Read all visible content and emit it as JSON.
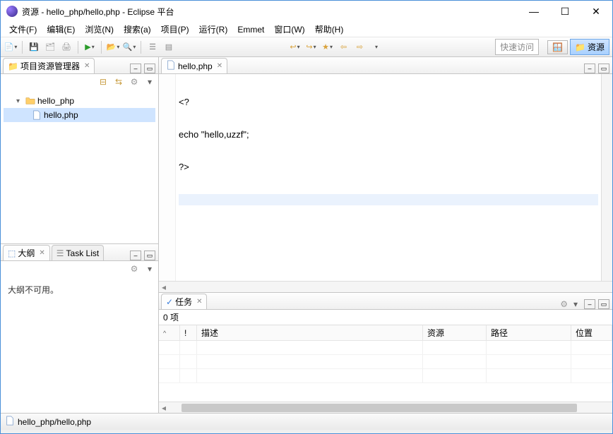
{
  "window": {
    "title": "资源 - hello_php/hello,php - Eclipse 平台"
  },
  "menu": {
    "file": "文件(F)",
    "edit": "编辑(E)",
    "navigate": "浏览(N)",
    "search": "搜索(a)",
    "project": "项目(P)",
    "run": "运行(R)",
    "emmet": "Emmet",
    "window": "窗口(W)",
    "help": "帮助(H)"
  },
  "toolbar": {
    "quick_access_placeholder": "快速访问",
    "perspective_label": "资源"
  },
  "explorer": {
    "tab_label": "项目资源管理器",
    "project_name": "hello_php",
    "file_name": "hello,php"
  },
  "outline": {
    "tab_label": "大纲",
    "tasklist_tab_label": "Task List",
    "empty_text": "大纲不可用。"
  },
  "editor": {
    "tab_label": "hello,php",
    "lines": [
      "<?",
      "echo \"hello,uzzf\";",
      "?>",
      ""
    ]
  },
  "tasks": {
    "tab_label": "任务",
    "count_text": "0 项",
    "columns": {
      "col0": "",
      "col1": "!",
      "col2": "描述",
      "col3": "资源",
      "col4": "路径",
      "col5": "位置"
    }
  },
  "statusbar": {
    "path": "hello_php/hello,php"
  }
}
